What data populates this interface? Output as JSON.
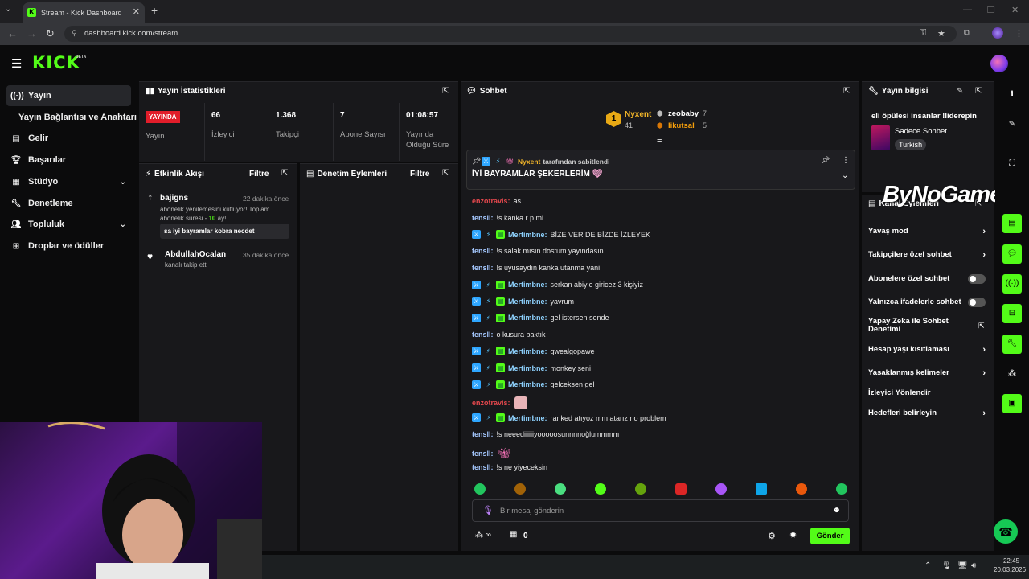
{
  "browser": {
    "tab_title": "Stream - Kick Dashboard",
    "url": "dashboard.kick.com/stream"
  },
  "header": {
    "logo": "KICK",
    "beta": "BETA"
  },
  "sidebar": {
    "items": [
      {
        "label": "Yayın",
        "icon": "broadcast-icon"
      },
      {
        "label": "Yayın Bağlantısı ve Anahtarı",
        "icon": ""
      },
      {
        "label": "Gelir",
        "icon": "revenue-icon"
      },
      {
        "label": "Başarılar",
        "icon": "trophy-icon"
      },
      {
        "label": "Stüdyo",
        "icon": "studio-icon"
      },
      {
        "label": "Denetleme",
        "icon": "wrench-icon"
      },
      {
        "label": "Topluluk",
        "icon": "community-icon"
      },
      {
        "label": "Droplar ve ödüller",
        "icon": "gift-icon"
      }
    ]
  },
  "stats": {
    "title": "Yayın İstatistikleri",
    "live_badge": "YAYINDA",
    "items": [
      {
        "value": "",
        "label": "Yayın"
      },
      {
        "value": "66",
        "label": "İzleyici"
      },
      {
        "value": "1.368",
        "label": "Takipçi"
      },
      {
        "value": "7",
        "label": "Abone Sayısı"
      },
      {
        "value": "01:08:57",
        "label": "Yayında Olduğu Süre"
      }
    ]
  },
  "activity": {
    "title": "Etkinlik Akışı",
    "filter": "Filtre",
    "events": [
      {
        "name": "bajigns",
        "time": "22 dakika önce",
        "desc_a": "abonelik yenilemesini kutluyor! Toplam abonelik süresi - ",
        "desc_num": "10",
        "desc_b": " ay!",
        "message": "sa iyi bayramlar kobra necdet"
      },
      {
        "name": "AbdullahOcalan",
        "time": "35 dakika önce",
        "desc": "kanalı takip etti"
      }
    ]
  },
  "moderation": {
    "title": "Denetim Eylemleri",
    "filter": "Filtre"
  },
  "chat": {
    "title": "Sohbet",
    "leaderboard": [
      {
        "rank": "1",
        "name": "Nyxent",
        "count": "41"
      },
      {
        "name": "zeobaby",
        "count": "7"
      },
      {
        "name": "likutsal",
        "count": "5"
      }
    ],
    "pinned": {
      "by": "Nyxent",
      "by_suffix": "tarafından sabitlendi",
      "text": "İYİ BAYRAMLAR ŞEKERLERİM"
    },
    "messages": [
      {
        "user": "enzotravis",
        "text": "as",
        "color": "#e5484d",
        "badges": false
      },
      {
        "user": "tensll",
        "text": "!s kanka r p mi",
        "color": "#a5c8ff",
        "badges": false
      },
      {
        "user": "Mertimbne",
        "text": "BİZE VER DE BİZDE İZLEYEK",
        "color": "#8fd3ff",
        "badges": true
      },
      {
        "user": "tensll",
        "text": "!s salak mısın dostum yayındasın",
        "color": "#a5c8ff",
        "badges": false
      },
      {
        "user": "tensll",
        "text": "!s uyusaydın kanka utanma yani",
        "color": "#a5c8ff",
        "badges": false
      },
      {
        "user": "Mertimbne",
        "text": "serkan abiyle giricez 3 kişiyiz",
        "color": "#8fd3ff",
        "badges": true
      },
      {
        "user": "Mertimbne",
        "text": "yavrum",
        "color": "#8fd3ff",
        "badges": true
      },
      {
        "user": "Mertimbne",
        "text": "gel istersen sende",
        "color": "#8fd3ff",
        "badges": true
      },
      {
        "user": "tensll",
        "text": "o kusura baktık",
        "color": "#a5c8ff",
        "badges": false
      },
      {
        "user": "Mertimbne",
        "text": "gwealgopawe",
        "color": "#8fd3ff",
        "badges": true
      },
      {
        "user": "Mertimbne",
        "text": "monkey seni",
        "color": "#8fd3ff",
        "badges": true
      },
      {
        "user": "Mertimbne",
        "text": "gelceksen gel",
        "color": "#8fd3ff",
        "badges": true
      },
      {
        "user": "enzotravis",
        "text": "",
        "color": "#e5484d",
        "badges": false,
        "emote": true
      },
      {
        "user": "Mertimbne",
        "text": "ranked atıyoz mm atarız no problem",
        "color": "#8fd3ff",
        "badges": true
      },
      {
        "user": "tensll",
        "text": "!s neeediiiiiiyooooosunnnnoğlummmm",
        "color": "#a5c8ff",
        "badges": false
      },
      {
        "user": "tensll",
        "text": "",
        "color": "#a5c8ff",
        "badges": false,
        "emote": true
      },
      {
        "user": "tensll",
        "text": "!s ne yiyeceksin",
        "color": "#a5c8ff",
        "badges": false
      }
    ],
    "input_placeholder": "Bir mesaj gönderin",
    "points": "0",
    "send": "Gönder"
  },
  "stream_info": {
    "title": "Yayın bilgisi",
    "stream_title": "eli öpülesi insanlar !liderepin",
    "category": "Sadece Sohbet",
    "language": "Turkish"
  },
  "channel_actions": {
    "title": "Kanal Eylemleri",
    "items": [
      {
        "label": "Yavaş mod",
        "control": "chevron"
      },
      {
        "label": "Takipçilere özel sohbet",
        "control": "chevron"
      },
      {
        "label": "Abonelere özel sohbet",
        "control": "toggle"
      },
      {
        "label": "Yalnızca ifadelerle sohbet",
        "control": "toggle"
      },
      {
        "label": "Yapay Zeka ile Sohbet Denetimi",
        "control": "external"
      },
      {
        "label": "Hesap yaşı kısıtlaması",
        "control": "chevron"
      },
      {
        "label": "Yasaklanmış kelimeler",
        "control": "chevron"
      },
      {
        "label": "İzleyici Yönlendir",
        "control": "none"
      },
      {
        "label": "Hedefleri belirleyin",
        "control": "chevron"
      }
    ]
  },
  "watermark": "ByNoGame",
  "taskbar": {
    "time": "22:45",
    "date": "20.03.2026"
  },
  "colors": {
    "accent": "#53fc18",
    "live": "#e11d2a",
    "panel": "#18181b"
  }
}
